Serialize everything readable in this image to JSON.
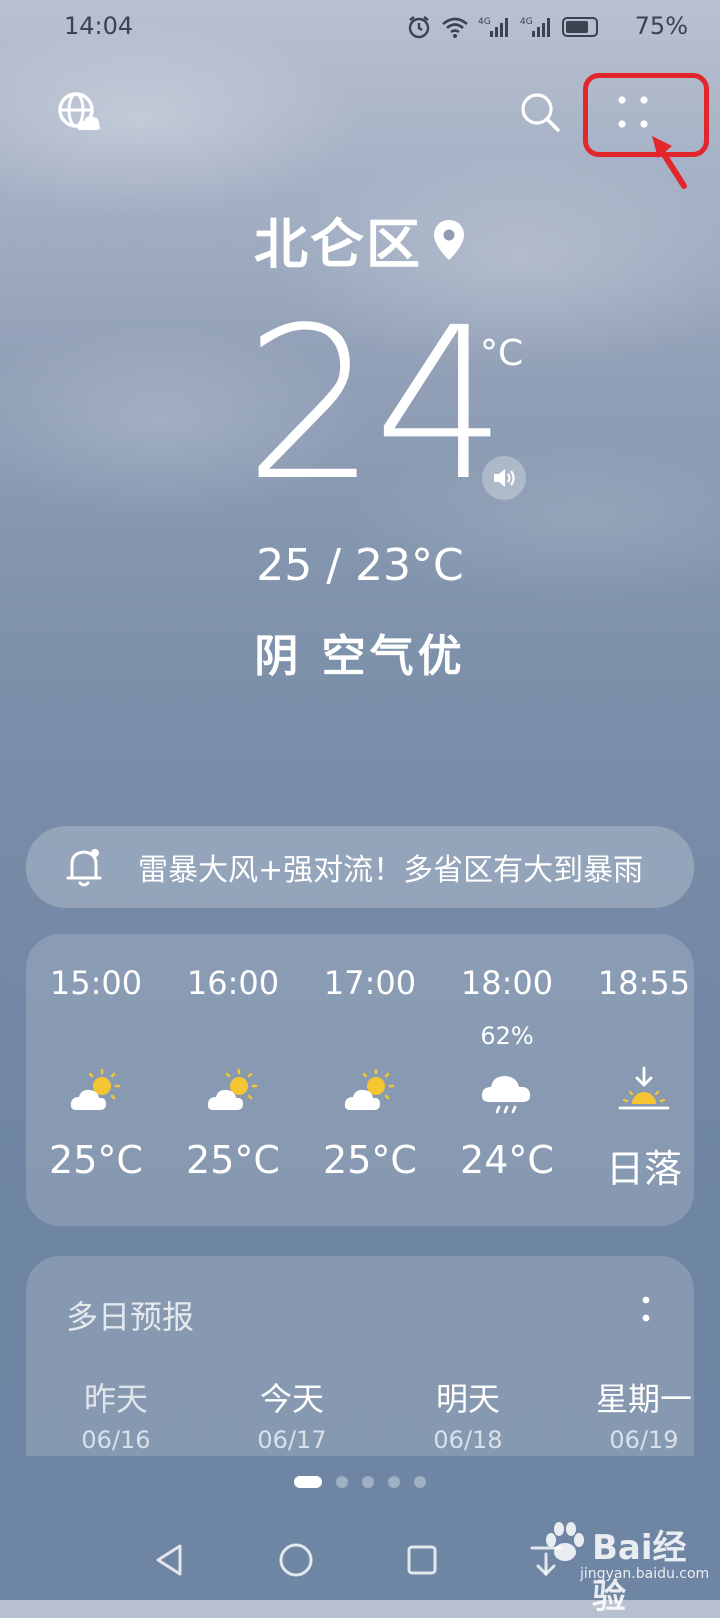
{
  "status_bar": {
    "time": "14:04",
    "battery_pct": "75%",
    "net_label_1": "4G",
    "net_label_2": "4G"
  },
  "location": {
    "name": "北仑区"
  },
  "current": {
    "temperature": "24",
    "unit": "°C",
    "range": "25 / 23°C",
    "condition": "阴  空气优"
  },
  "alert": {
    "text": "雷暴大风+强对流！多省区有大到暴雨"
  },
  "hourly": [
    {
      "time": "15:00",
      "pop": "",
      "icon": "partly-cloudy-icon",
      "temp": "25°C"
    },
    {
      "time": "16:00",
      "pop": "",
      "icon": "partly-cloudy-icon",
      "temp": "25°C"
    },
    {
      "time": "17:00",
      "pop": "",
      "icon": "partly-cloudy-icon",
      "temp": "25°C"
    },
    {
      "time": "18:00",
      "pop": "62%",
      "icon": "rain-cloud-icon",
      "temp": "24°C"
    },
    {
      "time": "18:55",
      "pop": "",
      "icon": "sunset-icon",
      "temp": "日落"
    }
  ],
  "multi_day": {
    "title": "多日预报",
    "days": [
      {
        "name": "昨天",
        "date": "06/16"
      },
      {
        "name": "今天",
        "date": "06/17"
      },
      {
        "name": "明天",
        "date": "06/18"
      },
      {
        "name": "星期一",
        "date": "06/19"
      }
    ]
  },
  "watermark": {
    "brand": "Bai经验",
    "sub": "jingyan.baidu.com"
  },
  "colors": {
    "highlight": "#e2262b",
    "sun": "#f5c533",
    "status_text": "#3c4250"
  }
}
